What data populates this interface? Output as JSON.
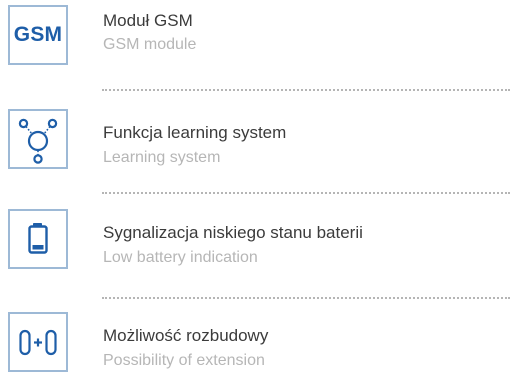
{
  "accent_color": "#1e5ea8",
  "border_color": "#9db9d6",
  "features": [
    {
      "icon": "gsm-text-icon",
      "icon_text": "GSM",
      "title_pl": "Moduł GSM",
      "title_en": "GSM module"
    },
    {
      "icon": "learning-system-icon",
      "title_pl": "Funkcja learning system",
      "title_en": "Learning system"
    },
    {
      "icon": "battery-icon",
      "title_pl": "Sygnalizacja niskiego stanu baterii",
      "title_en": "Low battery indication"
    },
    {
      "icon": "extension-icon",
      "title_pl": "Możliwość rozbudowy",
      "title_en": "Possibility of extension"
    }
  ]
}
